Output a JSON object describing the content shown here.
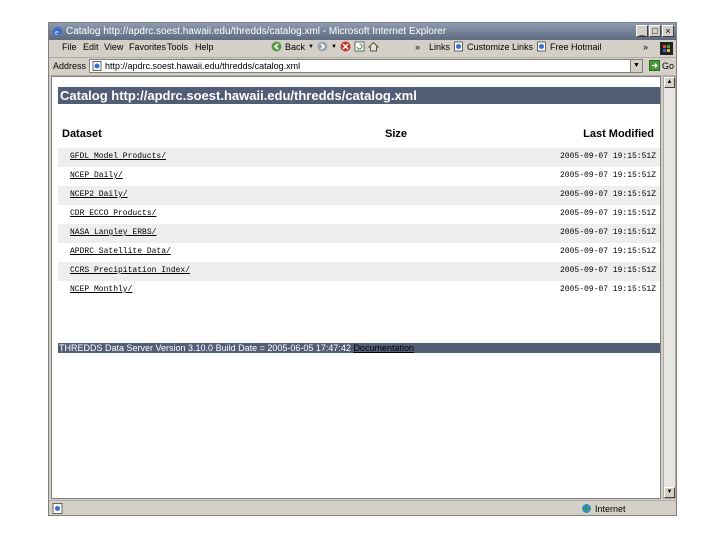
{
  "window": {
    "title": "Catalog http://apdrc.soest.hawaii.edu/thredds/catalog.xml - Microsoft Internet Explorer",
    "buttons": {
      "minimize": "_",
      "maximize": "□",
      "close": "×"
    }
  },
  "menubar": {
    "items": [
      "File",
      "Edit",
      "View",
      "Favorites",
      "Tools",
      "Help"
    ],
    "back_label": "Back",
    "chevron": "»",
    "links_label": "Links",
    "customize_links": "Customize Links",
    "free_hotmail": "Free Hotmail"
  },
  "address": {
    "label": "Address",
    "url": "http://apdrc.soest.hawaii.edu/thredds/catalog.xml",
    "go_label": "Go"
  },
  "page": {
    "heading": "Catalog http://apdrc.soest.hawaii.edu/thredds/catalog.xml",
    "columns": {
      "dataset": "Dataset",
      "size": "Size",
      "last_modified": "Last Modified"
    },
    "rows": [
      {
        "name": "GFDL Model Products/",
        "date": "2005-09-07 19:15:51Z"
      },
      {
        "name": "NCEP Daily/",
        "date": "2005-09-07 19:15:51Z"
      },
      {
        "name": "NCEP2 Daily/",
        "date": "2005-09-07 19:15:51Z"
      },
      {
        "name": "CDR ECCO Products/",
        "date": "2005-09-07 19:15:51Z"
      },
      {
        "name": "NASA Langley ERBS/",
        "date": "2005-09-07 19:15:51Z"
      },
      {
        "name": "APDRC Satellite Data/",
        "date": "2005-09-07 19:15:51Z"
      },
      {
        "name": "CCRS Precipitation Index/",
        "date": "2005-09-07 19:15:51Z"
      },
      {
        "name": "NCEP Monthly/",
        "date": "2005-09-07 19:15:51Z"
      }
    ],
    "footer": {
      "version": "THREDDS Data Server Version 3.10.0 Build Date = 2005-06-05 17:47:42",
      "doc_link": "Documentation"
    }
  },
  "status": {
    "zone": "Internet"
  }
}
